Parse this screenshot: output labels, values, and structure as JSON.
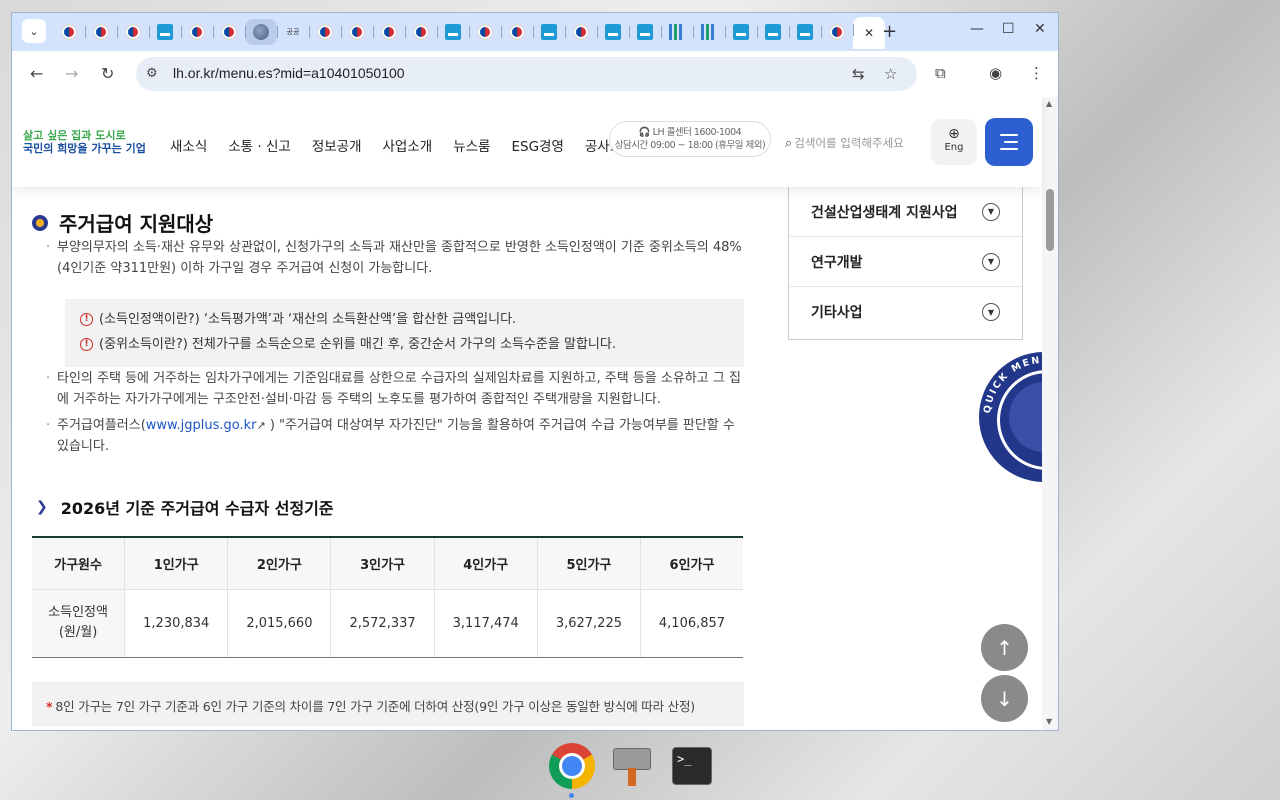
{
  "browser": {
    "tab_count_favicons": [
      "kr",
      "kr",
      "kr",
      "lh",
      "kr",
      "kr",
      "globe",
      "word",
      "kr",
      "kr",
      "kr",
      "kr",
      "lh",
      "kr",
      "kr",
      "lh",
      "kr",
      "lh",
      "lh",
      "bars",
      "bars",
      "lh",
      "lh",
      "lh",
      "kr"
    ],
    "word_favicon_text": "공공",
    "url": "lh.or.kr/menu.es?mid=a10401050100"
  },
  "site": {
    "logo_line1": "살고 싶은 집과 도시로",
    "logo_line2": "국민의 희망을 가꾸는 기업",
    "nav": [
      "새소식",
      "소통 · 신고",
      "정보공개",
      "사업소개",
      "뉴스룸",
      "ESG경영",
      "공사소개"
    ],
    "callcenter_line1": "🎧 LH 콜센터 1600-1004",
    "callcenter_line2": "상담시간 09:00 ~ 18:00 (휴무일 제외)",
    "search_placeholder": "검색어를 입력해주세요",
    "eng_label": "Eng"
  },
  "main": {
    "heading": "주거급여 지원대상",
    "para1": "부양의무자의 소득·재산 유무와 상관없이, 신청가구의 소득과 재산만을 종합적으로 반영한 소득인정액이 기준 중위소득의 48%(4인기준 약311만원) 이하 가구일 경우 주거급여 신청이 가능합니다.",
    "note1": "(소득인정액이란?) ‘소득평가액’과 ‘재산의 소득환산액’을 합산한 금액입니다.",
    "note2": "(중위소득이란?) 전체가구를 소득순으로 순위를 매긴 후, 중간순서 가구의 소득수준을 말합니다.",
    "para2": "타인의 주택 등에 거주하는 임차가구에게는 기준임대료를 상한으로 수급자의 실제임차료를 지원하고, 주택 등을 소유하고 그 집에 거주하는 자가가구에게는 구조안전·설비·마감 등 주택의 노후도를 평가하여 종합적인 주택개량을 지원합니다.",
    "para3_prefix": "주거급여플러스(",
    "para3_link": "www.jgplus.go.kr",
    "para3_suffix": " ) \"주거급여 대상여부 자가진단\" 기능을 활용하여 주거급여 수급 가능여부를 판단할 수 있습니다.",
    "subheading": "2026년 기준 주거급여 수급자 선정기준",
    "table": {
      "headers": [
        "가구원수",
        "1인가구",
        "2인가구",
        "3인가구",
        "4인가구",
        "5인가구",
        "6인가구"
      ],
      "row_header_line1": "소득인정액",
      "row_header_line2": "(원/월)",
      "values": [
        "1,230,834",
        "2,015,660",
        "2,572,337",
        "3,117,474",
        "3,627,225",
        "4,106,857"
      ]
    },
    "footnote_star": "*",
    "footnote": "8인 가구는 7인 가구 기준과 6인 가구 기준의 차이를 7인 가구 기준에 더하여 산정(9인 가구 이상은 동일한 방식에 따라 산정)"
  },
  "sidebar": {
    "items": [
      "건설산업생태계 지원사업",
      "연구개발",
      "기타사업"
    ]
  },
  "quick_menu_text": "QUICK MENU SERVICE",
  "colors": {
    "accent": "#2e5fd1",
    "navy": "#22378a",
    "link": "#1a56c8",
    "alert": "#d62a2a"
  }
}
